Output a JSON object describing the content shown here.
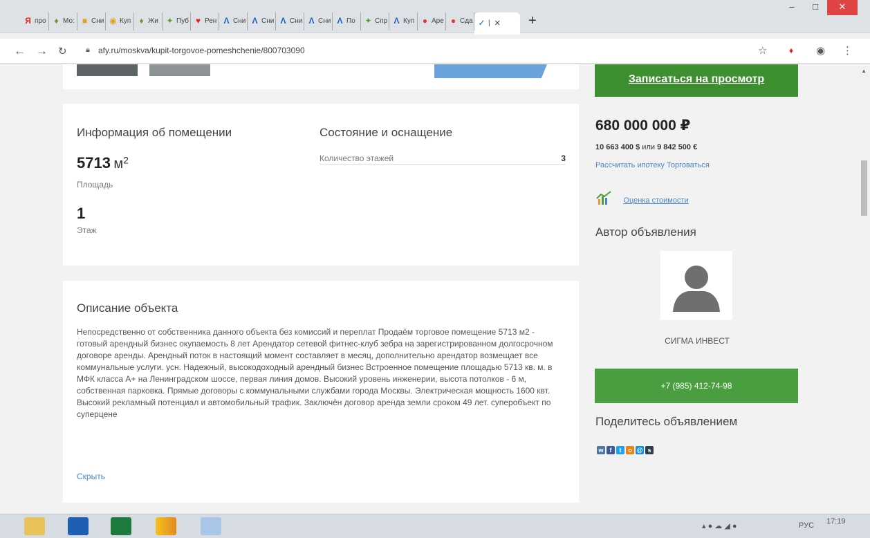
{
  "browser": {
    "tabs": [
      {
        "icon": "yandex-icon",
        "glyph": "Я",
        "color": "#e52620",
        "label": "про"
      },
      {
        "icon": "leaf-icon",
        "glyph": "♦",
        "color": "#6a9a2c",
        "label": "Мо:"
      },
      {
        "icon": "house-icon",
        "glyph": "■",
        "color": "#e8a219",
        "label": "Сни"
      },
      {
        "icon": "search-orange-icon",
        "glyph": "◉",
        "color": "#e8a219",
        "label": "Куп"
      },
      {
        "icon": "leaf-icon",
        "glyph": "♦",
        "color": "#6a9a2c",
        "label": "Жи"
      },
      {
        "icon": "sprout-icon",
        "glyph": "✦",
        "color": "#5aa02c",
        "label": "Пуб"
      },
      {
        "icon": "pin-icon",
        "glyph": "♥",
        "color": "#e52620",
        "label": "Рен"
      },
      {
        "icon": "m-blue-icon",
        "glyph": "Λ",
        "color": "#1565c0",
        "label": "Сни"
      },
      {
        "icon": "m-blue-icon",
        "glyph": "Λ",
        "color": "#1565c0",
        "label": "Сни"
      },
      {
        "icon": "m-blue-icon",
        "glyph": "Λ",
        "color": "#1565c0",
        "label": "Сни"
      },
      {
        "icon": "m-blue-icon",
        "glyph": "Λ",
        "color": "#1565c0",
        "label": "Сни"
      },
      {
        "icon": "m-blue-icon",
        "glyph": "Λ",
        "color": "#1565c0",
        "label": "По"
      },
      {
        "icon": "sprout-icon",
        "glyph": "✦",
        "color": "#5aa02c",
        "label": "Спр"
      },
      {
        "icon": "m-blue-icon",
        "glyph": "Λ",
        "color": "#1565c0",
        "label": "Куп"
      },
      {
        "icon": "red-circle-icon",
        "glyph": "●",
        "color": "#e53935",
        "label": "Аре"
      },
      {
        "icon": "red-circle-icon",
        "glyph": "●",
        "color": "#e53935",
        "label": "Сда"
      }
    ],
    "active_tab": {
      "icon": "afy-icon",
      "glyph": "✓",
      "color": "#1565c0",
      "label": "|"
    },
    "url": "afy.ru/moskva/kupit-torgovoe-pomeshchenie/800703090"
  },
  "listing": {
    "view_button": "Записаться на просмотр",
    "info": {
      "title": "Информация об помещении",
      "area_value": "5713",
      "area_unit": "м",
      "area_sup": "2",
      "area_label": "Площадь",
      "floor_value": "1",
      "floor_label": "Этаж"
    },
    "condition": {
      "title": "Состояние и оснащение",
      "floors_label": "Количество этажей",
      "floors_value": "3"
    },
    "description": {
      "title": "Описание объекта",
      "text": "Непосредственно от собственника данного объекта без комиссий и переплат Продаём торговое помещение 5713 м2 - готовый арендный бизнес окупаемость 8 лет Арендатор сетевой фитнес-клуб зебра на зарегистрированном долгосрочном договоре аренды. Арендный поток в настоящий момент составляет в месяц, дополнительно арендатор возмещает все коммунальные услуги. усн. Надежный, высокодоходный арендный бизнес Встроенное помещение площадью 5713 кв. м. в МФК класса А+ на Ленинградском шоссе, первая линия домов. Высокий уровень инженерии, высота потолков - 6 м, собственная парковка. Прямые договоры с коммунальными службами города Москвы. Электрическая мощность 1600 квт. Высокий рекламный потенциал и автомобильный трафик. Заключён договор аренда земли сроком 49 лет. суперобъект по суперцене",
      "hide_link": "Скрыть"
    },
    "price": {
      "main": "680 000 000 ₽",
      "usd": "10 663 400 $",
      "or": "или",
      "eur": "9 842 500 €",
      "mortgage_link": "Рассчитать ипотеку",
      "bargain_link": "Торговаться",
      "estimate_link": "Оценка стоимости"
    },
    "author": {
      "title": "Автор объявления",
      "name": "СИГМА ИНВЕСТ",
      "phone": "+7 (985) 412-74-98"
    },
    "share": {
      "title": "Поделитесь объявлением",
      "networks": [
        {
          "name": "vk-icon",
          "glyph": "w",
          "color": "#4a76a8"
        },
        {
          "name": "facebook-icon",
          "glyph": "f",
          "color": "#3b5998"
        },
        {
          "name": "twitter-icon",
          "glyph": "t",
          "color": "#1da1f2"
        },
        {
          "name": "odnoklassniki-icon",
          "glyph": "o",
          "color": "#ee8208"
        },
        {
          "name": "mail-icon",
          "glyph": "@",
          "color": "#168de2"
        },
        {
          "name": "share-icon",
          "glyph": "s",
          "color": "#2c3e50"
        }
      ]
    }
  },
  "taskbar": {
    "lang": "РУС",
    "time": "17:19"
  }
}
